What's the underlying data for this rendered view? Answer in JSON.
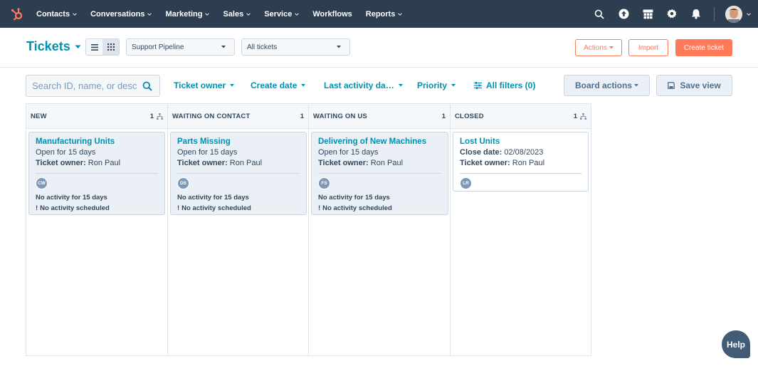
{
  "nav": {
    "items": [
      {
        "label": "Contacts",
        "has_caret": true
      },
      {
        "label": "Conversations",
        "has_caret": true
      },
      {
        "label": "Marketing",
        "has_caret": true
      },
      {
        "label": "Sales",
        "has_caret": true
      },
      {
        "label": "Service",
        "has_caret": true
      },
      {
        "label": "Workflows",
        "has_caret": false
      },
      {
        "label": "Reports",
        "has_caret": true
      }
    ],
    "icons": [
      "search-icon",
      "upgrade-icon",
      "marketplace-icon",
      "settings-icon",
      "notifications-icon"
    ],
    "colors": {
      "background": "#2d3e50",
      "logo": "#ff7a59"
    }
  },
  "header": {
    "title": "Tickets",
    "pipeline_select": "Support Pipeline",
    "view_select": "All tickets",
    "actions_label": "Actions",
    "import_label": "Import",
    "create_label": "Create ticket"
  },
  "filters": {
    "search_placeholder": "Search ID, name, or desc",
    "ticket_owner": "Ticket owner",
    "create_date": "Create date",
    "last_activity": "Last activity da…",
    "priority": "Priority",
    "all_filters": "All filters (0)",
    "board_actions": "Board actions",
    "save_view": "Save view"
  },
  "board": {
    "columns": [
      {
        "title": "NEW",
        "count": "1",
        "show_icon": true,
        "card": {
          "title": "Manufacturing Units",
          "line1": "Open for 15 days",
          "owner_label": "Ticket owner:",
          "owner": "Ron Paul",
          "initials": "CW",
          "activity": "No activity for 15 days",
          "scheduled": "No activity scheduled"
        }
      },
      {
        "title": "WAITING ON CONTACT",
        "count": "1",
        "show_icon": false,
        "card": {
          "title": "Parts Missing",
          "line1": "Open for 15 days",
          "owner_label": "Ticket owner:",
          "owner": "Ron Paul",
          "initials": "DS",
          "activity": "No activity for 15 days",
          "scheduled": "No activity scheduled"
        }
      },
      {
        "title": "WAITING ON US",
        "count": "1",
        "show_icon": false,
        "card": {
          "title": "Delivering of New Machines",
          "line1": "Open for 15 days",
          "owner_label": "Ticket owner:",
          "owner": "Ron Paul",
          "initials": "FS",
          "activity": "No activity for 15 days",
          "scheduled": "No activity scheduled"
        }
      },
      {
        "title": "CLOSED",
        "count": "1",
        "show_icon": true,
        "card": {
          "title": "Lost Units",
          "close_label": "Close date:",
          "close_date": "02/08/2023",
          "owner_label": "Ticket owner:",
          "owner": "Ron Paul",
          "initials": "LR"
        }
      }
    ]
  },
  "help": {
    "label": "Help"
  }
}
